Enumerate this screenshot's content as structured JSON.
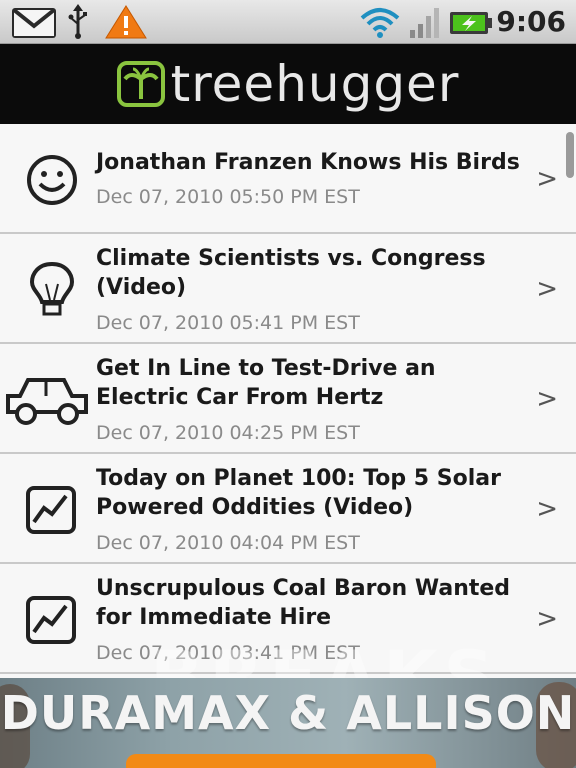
{
  "status_bar": {
    "time": "9:06",
    "icons": [
      "gmail-icon",
      "usb-icon",
      "warning-icon",
      "wifi-icon",
      "signal-icon",
      "battery-charging-icon"
    ]
  },
  "header": {
    "logo_text": "treehugger",
    "logo_icon": "palm-tree-icon",
    "accent_color": "#8ac43f"
  },
  "articles": [
    {
      "title": "Jonathan Franzen Knows His Birds",
      "date": "Dec 07, 2010 05:50 PM EST",
      "icon": "smiley-icon"
    },
    {
      "title": "Climate Scientists vs. Congress (Video)",
      "date": "Dec 07, 2010 05:41 PM EST",
      "icon": "lightbulb-icon"
    },
    {
      "title": "Get In Line to Test-Drive an Electric Car From Hertz",
      "date": "Dec 07, 2010 04:25 PM EST",
      "icon": "car-icon"
    },
    {
      "title": "Today on Planet 100: Top 5 Solar Powered Oddities (Video)",
      "date": "Dec 07, 2010 04:04 PM EST",
      "icon": "chart-icon"
    },
    {
      "title": "Unscrupulous Coal Baron Wanted for Immediate Hire",
      "date": "Dec 07, 2010 03:41 PM EST",
      "icon": "chart-icon"
    }
  ],
  "chevron": ">",
  "ad": {
    "headline": "DURAMAX & ALLISON",
    "watermark": "BREAKS"
  }
}
